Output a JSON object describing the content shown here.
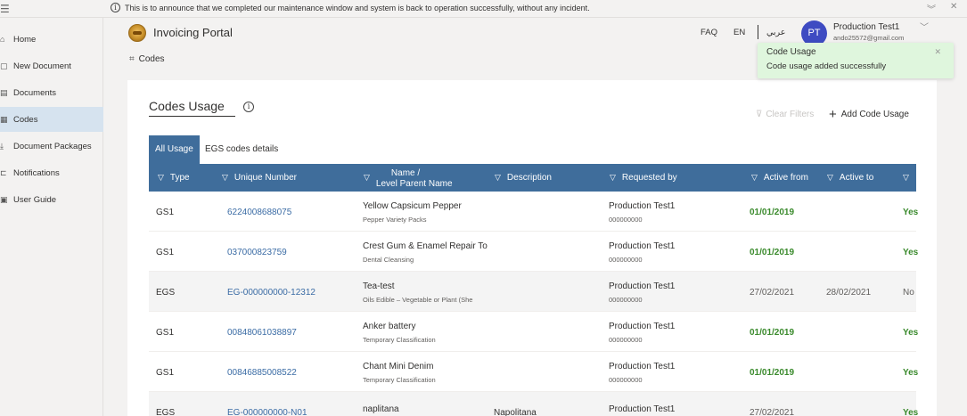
{
  "announcement": "This is to announce that we completed our maintenance window and system is back to operation successfully, without any incident.",
  "sidebar": {
    "items": [
      {
        "label": "Home",
        "icon": "home-icon",
        "glyph": "⌂"
      },
      {
        "label": "New Document",
        "icon": "new-document-icon",
        "glyph": "▢"
      },
      {
        "label": "Documents",
        "icon": "documents-icon",
        "glyph": "▤"
      },
      {
        "label": "Codes",
        "icon": "codes-icon",
        "glyph": "▦",
        "active": true
      },
      {
        "label": "Document Packages",
        "icon": "download-icon",
        "glyph": "⤓"
      },
      {
        "label": "Notifications",
        "icon": "notifications-icon",
        "glyph": "⊏"
      },
      {
        "label": "User Guide",
        "icon": "user-guide-icon",
        "glyph": "▣"
      }
    ]
  },
  "header": {
    "title": "Invoicing Portal",
    "faq": "FAQ",
    "lang_en": "EN",
    "lang_ar": "عربي",
    "avatar_initials": "PT",
    "user_name": "Production Test1",
    "user_email": "ando25572@gmail.com"
  },
  "breadcrumb": {
    "label": "Codes"
  },
  "toast": {
    "title": "Code Usage",
    "message": "Code usage added successfully",
    "color": "#dff6dd"
  },
  "main": {
    "title": "Codes Usage",
    "clear_filters": "Clear Filters",
    "add_code_usage": "Add Code Usage",
    "tabs": [
      "All Usage",
      "EGS codes details"
    ],
    "columns": {
      "type": "Type",
      "unique_number": "Unique Number",
      "name_line1": "Name /",
      "name_line2": "Level Parent Name",
      "description": "Description",
      "requested_by": "Requested by",
      "active_from": "Active from",
      "active_to": "Active to"
    },
    "rows": [
      {
        "type": "GS1",
        "number": "6224008688075",
        "name": "Yellow Capsicum Pepper",
        "parent": "Pepper Variety Packs",
        "description": "",
        "requested_by": "Production Test1",
        "requester_id": "000000000",
        "active_from": "01/01/2019",
        "active_to": "",
        "status": "Yes"
      },
      {
        "type": "GS1",
        "number": "037000823759",
        "name": "Crest Gum & Enamel Repair To",
        "parent": "Dental Cleansing",
        "description": "",
        "requested_by": "Production Test1",
        "requester_id": "000000000",
        "active_from": "01/01/2019",
        "active_to": "",
        "status": "Yes"
      },
      {
        "type": "EGS",
        "number": "EG-000000000-12312",
        "name": "Tea-test",
        "parent": "Oils Edible – Vegetable or Plant (She",
        "description": "",
        "requested_by": "Production Test1",
        "requester_id": "000000000",
        "active_from": "27/02/2021",
        "active_to": "28/02/2021",
        "status": "No"
      },
      {
        "type": "GS1",
        "number": "00848061038897",
        "name": "Anker battery",
        "parent": "Temporary Classification",
        "description": "",
        "requested_by": "Production Test1",
        "requester_id": "000000000",
        "active_from": "01/01/2019",
        "active_to": "",
        "status": "Yes"
      },
      {
        "type": "GS1",
        "number": "00846885008522",
        "name": "Chant Mini Denim",
        "parent": "Temporary Classification",
        "description": "",
        "requested_by": "Production Test1",
        "requester_id": "000000000",
        "active_from": "01/01/2019",
        "active_to": "",
        "status": "Yes"
      },
      {
        "type": "EGS",
        "number": "EG-000000000-N01",
        "name": "naplitana",
        "parent": "",
        "description": "Napolitana",
        "requested_by": "Production Test1",
        "requester_id": "",
        "active_from": "27/02/2021",
        "active_to": "",
        "status": "Yes"
      }
    ]
  },
  "colors": {
    "accent": "#3f6d9b",
    "link": "#3b6ca5",
    "active_green": "#3a8a2c",
    "avatar": "#3e4bc2"
  }
}
